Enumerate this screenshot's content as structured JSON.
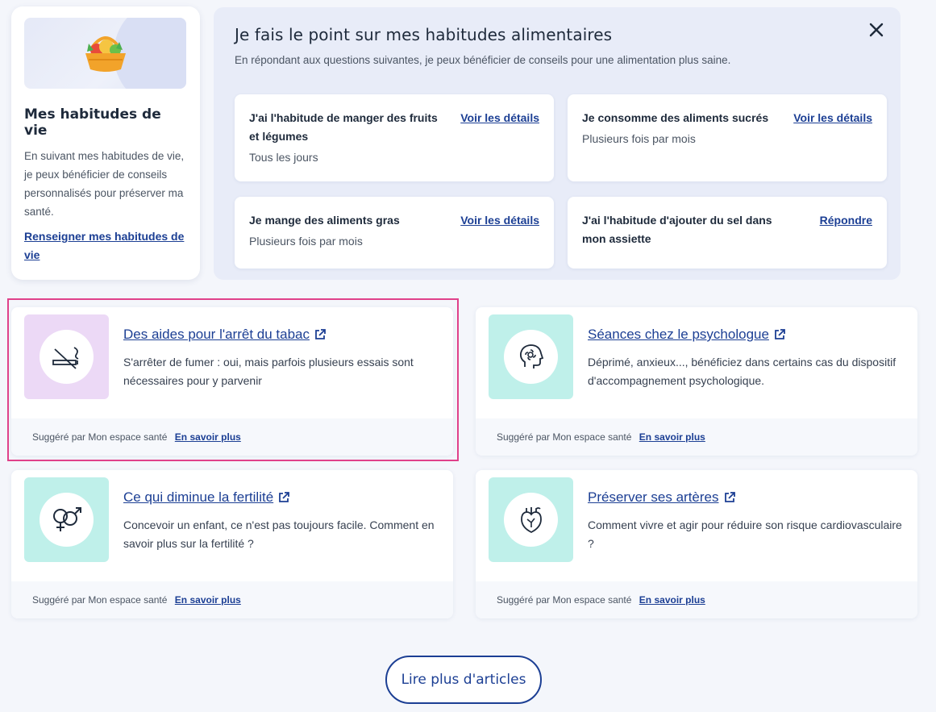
{
  "habits": {
    "title": "Mes habitudes de vie",
    "description": "En suivant mes habitudes de vie, je peux bénéficier de conseils personnalisés pour préserver ma santé.",
    "link": "Renseigner mes habitudes de vie",
    "illustration_icon": "fruit-basket-icon"
  },
  "quiz": {
    "title": "Je fais le point sur mes habitudes alimentaires",
    "subtitle": "En répondant aux questions suivantes, je peux bénéficier de conseils pour une alimentation plus saine.",
    "close_icon": "close-icon",
    "questions": [
      {
        "question": "J'ai l'habitude de manger des fruits et légumes",
        "answer": "Tous les jours",
        "action": "Voir les détails"
      },
      {
        "question": "Je consomme des aliments sucrés",
        "answer": "Plusieurs fois par mois",
        "action": "Voir les détails"
      },
      {
        "question": "Je mange des aliments gras",
        "answer": "Plusieurs fois par mois",
        "action": "Voir les détails"
      },
      {
        "question": "J'ai l'habitude d'ajouter du sel dans mon assiette",
        "answer": "",
        "action": "Répondre"
      }
    ]
  },
  "articles": [
    {
      "title": "Des aides pour l'arrêt du tabac",
      "description": "S'arrêter de fumer : oui, mais parfois plusieurs essais sont nécessaires pour y parvenir",
      "icon": "no-smoking-icon",
      "suggested": "Suggéré par Mon espace santé",
      "more": "En savoir plus",
      "thumb_color": "#ecd9f6"
    },
    {
      "title": "Séances chez le psychologue",
      "description": "Déprimé, anxieux..., bénéficiez dans certains cas du dispositif d'accompagnement psychologique.",
      "icon": "head-flower-icon",
      "suggested": "Suggéré par Mon espace santé",
      "more": "En savoir plus",
      "thumb_color": "#bff0ea"
    },
    {
      "title": "Ce qui diminue la fertilité",
      "description": "Concevoir un enfant, ce n'est pas toujours facile. Comment en savoir plus sur la fertilité ?",
      "icon": "gender-symbols-icon",
      "suggested": "Suggéré par Mon espace santé",
      "more": "En savoir plus",
      "thumb_color": "#bff0ea"
    },
    {
      "title": "Préserver ses artères",
      "description": "Comment vivre et agir pour réduire son risque cardiovasculaire ?",
      "icon": "heart-organ-icon",
      "suggested": "Suggéré par Mon espace santé",
      "more": "En savoir plus",
      "thumb_color": "#bff0ea"
    }
  ],
  "more_button": "Lire plus d'articles",
  "colors": {
    "link": "#1c3f94",
    "highlight": "#e0418a",
    "page_bg": "#f4f6fb",
    "quiz_bg": "#e8ecf8"
  }
}
